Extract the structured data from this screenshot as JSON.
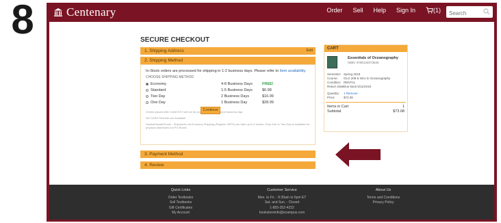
{
  "step_number": "8",
  "header": {
    "logo_text": "Centenary",
    "nav": [
      "Order",
      "Sell",
      "Help",
      "Sign In"
    ],
    "cart_count": "(1)",
    "search_placeholder": "Search"
  },
  "checkout": {
    "title": "SECURE CHECKOUT",
    "steps": [
      {
        "label": "1. Shipping Address",
        "edit": "Edit"
      },
      {
        "label": "2. Shipping Method"
      },
      {
        "label": "3. Payment Method"
      },
      {
        "label": "4. Review"
      }
    ],
    "shipping": {
      "info_text": "In-Stock orders are processed for shipping in 1-2 business days. Please refer to",
      "info_link": "Item availability.",
      "choose_label": "CHOOSE SHIPPING METHOD",
      "options": [
        {
          "name": "Economy",
          "days": "4-8 Business Days",
          "price": "FREE!",
          "selected": true
        },
        {
          "name": "Standard",
          "days": "1-5 Business Days",
          "price": "$6.98",
          "selected": false
        },
        {
          "name": "Two Day",
          "days": "2 Business Days",
          "price": "$16.99",
          "selected": false
        },
        {
          "name": "One Day",
          "days": "1 Business Day",
          "price": "$28.99",
          "selected": false
        }
      ],
      "notes": [
        "Orders placed after 11AM EST will not be processed until the next business day.",
        "NO CASH Refunds are Available",
        "Alaska/Hawaii/Guam - Shipments via Economy Shipping (Regular USPS) can take up to 4 weeks. Only One or Two Day is available for physical addresses not PO Boxes."
      ],
      "continue_label": "Continue"
    }
  },
  "cart": {
    "title": "CART",
    "item": {
      "title": "Essentials of Oceanography",
      "isbn": "ISBN: 9780134073545",
      "meta": [
        {
          "k": "Semester:",
          "v": "Spring 2018"
        },
        {
          "k": "Course:",
          "v": "GLG 208-6 Intro to Oceanography"
        },
        {
          "k": "Condition:",
          "v": "RENTAL"
        },
        {
          "k": "Return Date:",
          "v": "Due back 5/11/2018"
        },
        {
          "k": "Quantity:",
          "v": "1 Remove",
          "link": true
        },
        {
          "k": "Price:",
          "v": "$73.08"
        }
      ]
    },
    "items_label": "Items in Cart",
    "items_count": "1",
    "subtotal_label": "Subtotal",
    "subtotal_value": "$73.08"
  },
  "footer": {
    "quick_links": {
      "title": "Quick Links",
      "items": [
        "Order Textbooks",
        "Sell Textbooks",
        "Gift Certificates",
        "My Account"
      ]
    },
    "customer_service": {
      "title": "Customer Service",
      "items": [
        "Mon. to Fri. - 8:30am to 6pm ET",
        "Sat. and Sun. - Closed",
        "1-855-252-4222",
        "bookstoreinfo@ecampus.com"
      ]
    },
    "about": {
      "title": "About Us",
      "items": [
        "Terms and Conditions",
        "Privacy Policy"
      ]
    }
  },
  "colors": {
    "brand": "#7a1424",
    "accent": "#f4a93a",
    "arrow": "#7a1424"
  }
}
